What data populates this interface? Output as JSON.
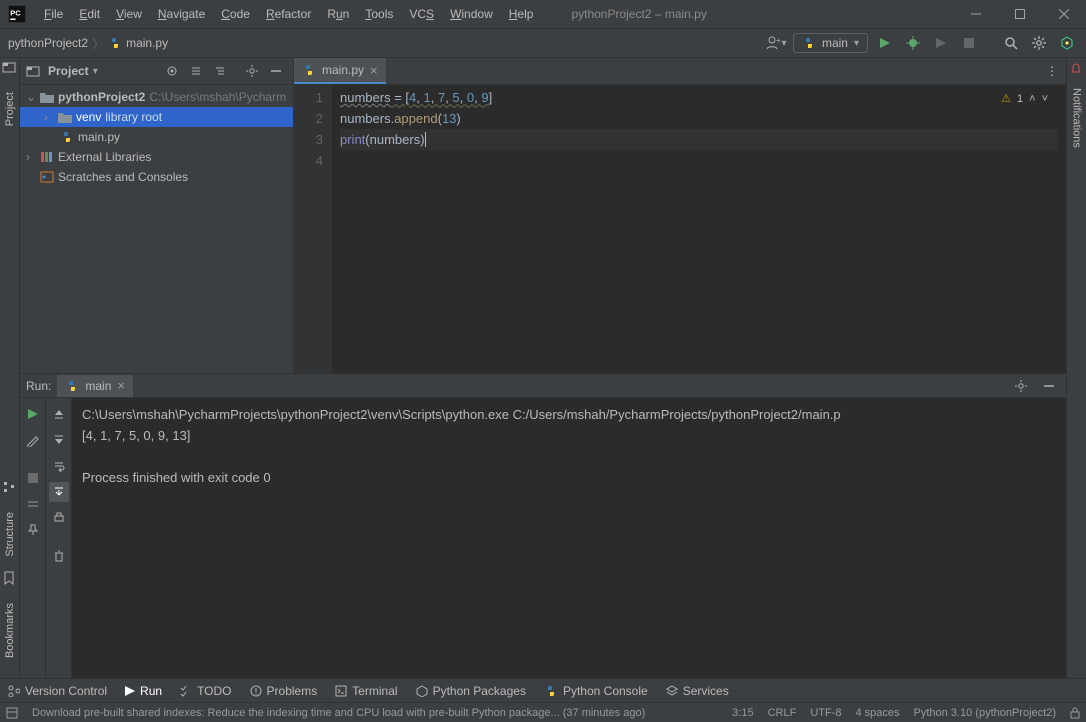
{
  "window": {
    "title": "pythonProject2 – main.py"
  },
  "menu": [
    "File",
    "Edit",
    "View",
    "Navigate",
    "Code",
    "Refactor",
    "Run",
    "Tools",
    "VCS",
    "Window",
    "Help"
  ],
  "breadcrumb": {
    "project": "pythonProject2",
    "file": "main.py"
  },
  "run_config": {
    "label": "main"
  },
  "project": {
    "panel_label": "Project",
    "root_name": "pythonProject2",
    "root_path": "C:\\Users\\mshah\\Pycharm",
    "venv_label": "venv",
    "venv_hint": "library root",
    "file1": "main.py",
    "ext_libs": "External Libraries",
    "scratches": "Scratches and Consoles"
  },
  "editor": {
    "tab": "main.py",
    "lines": [
      "1",
      "2",
      "3",
      "4"
    ],
    "line1_a": "numbers",
    "line1_b": " = [",
    "line1_n1": "4",
    "line1_n2": "1",
    "line1_n3": "7",
    "line1_n4": "5",
    "line1_n5": "0",
    "line1_n6": "9",
    "line1_c": "]",
    "line2_a": "numbers",
    "line2_b": ".",
    "line2_c": "append",
    "line2_d": "(",
    "line2_n": "13",
    "line2_e": ")",
    "line3_a": "print",
    "line3_b": "(",
    "line3_c": "numbers",
    "line3_d": ")",
    "warn_count": "1"
  },
  "run": {
    "label": "Run:",
    "tab": "main",
    "out_path": "C:\\Users\\mshah\\PycharmProjects\\pythonProject2\\venv\\Scripts\\python.exe C:/Users/mshah/PycharmProjects/pythonProject2/main.p",
    "out_result": "[4, 1, 7, 5, 0, 9, 13]",
    "out_exit": "Process finished with exit code 0"
  },
  "bottom_tools": {
    "version_control": "Version Control",
    "run": "Run",
    "todo": "TODO",
    "problems": "Problems",
    "terminal": "Terminal",
    "py_packages": "Python Packages",
    "py_console": "Python Console",
    "services": "Services"
  },
  "status": {
    "msg": "Download pre-built shared indexes: Reduce the indexing time and CPU load with pre-built Python package... (37 minutes ago)",
    "pos": "3:15",
    "eol": "CRLF",
    "enc": "UTF-8",
    "indent": "4 spaces",
    "interp": "Python 3.10 (pythonProject2)"
  },
  "stripes": {
    "notifications": "Notifications",
    "project": "Project",
    "structure": "Structure",
    "bookmarks": "Bookmarks"
  }
}
